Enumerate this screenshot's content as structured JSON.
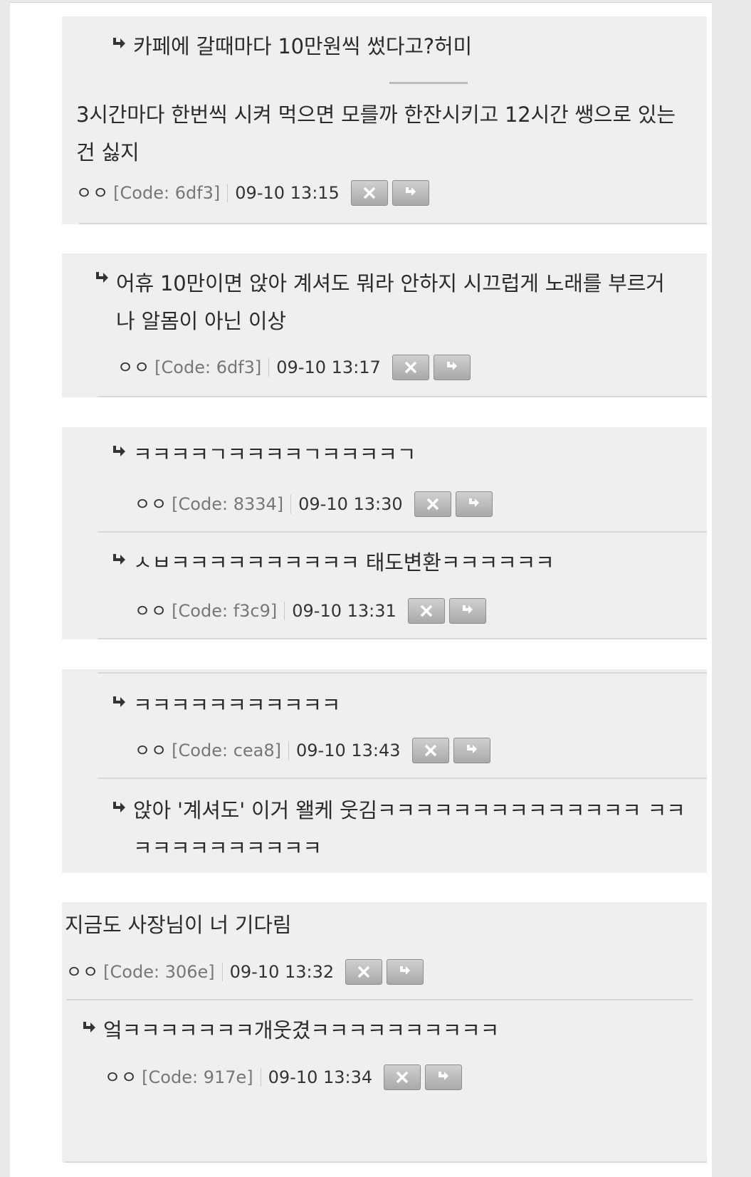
{
  "comments": [
    {
      "text": "카페에 갈때마다 10만원씩 썼다고?허미"
    },
    {
      "text": "3시간마다 한번씩 시켜 먹으면 모를까 한잔시키고 12시간 쌩으로 있는건 싫지",
      "author": "ㅇㅇ",
      "code": "[Code: 6df3]",
      "time": "09-10 13:15"
    },
    {
      "text": "어휴 10만이면 앉아 계셔도 뭐라 안하지 시끄럽게 노래를 부르거나 알몸이 아닌 이상",
      "author": "ㅇㅇ",
      "code": "[Code: 6df3]",
      "time": "09-10 13:17"
    },
    {
      "text": "ㅋㅋㅋㅋㄱㅋㅋㅋㅋㄱㅋㅋㅋㅋㄱ",
      "author": "ㅇㅇ",
      "code": "[Code: 8334]",
      "time": "09-10 13:30"
    },
    {
      "text": "ㅅㅂㅋㅋㅋㅋㅋㅋㅋㅋㅋㅋ 태도변환ㅋㅋㅋㅋㅋㅋ",
      "author": "ㅇㅇ",
      "code": "[Code: f3c9]",
      "time": "09-10 13:31"
    },
    {
      "text": "ㅋㅋㅋㅋㅋㅋㅋㅋㅋㅋㅋ",
      "author": "ㅇㅇ",
      "code": "[Code: cea8]",
      "time": "09-10 13:43"
    },
    {
      "text": "앉아 '계셔도' 이거 왤케 웃김ㅋㅋㅋㅋㅋㅋㅋㅋㅋㅋㅋㅋㅋㅋ ㅋㅋㅋㅋㅋㅋㅋㅋㅋㅋㅋㅋ"
    },
    {
      "text": "지금도 사장님이 너 기다림",
      "author": "ㅇㅇ",
      "code": "[Code: 306e]",
      "time": "09-10 13:32"
    },
    {
      "text": "엌ㅋㅋㅋㅋㅋㅋㅋ개웃겼ㅋㅋㅋㅋㅋㅋㅋㅋㅋㅋ",
      "author": "ㅇㅇ",
      "code": "[Code: 917e]",
      "time": "09-10 13:34"
    }
  ],
  "icons": {
    "reply_arrow": "reply-arrow-icon",
    "delete": "close-icon",
    "reply": "reply-icon"
  }
}
